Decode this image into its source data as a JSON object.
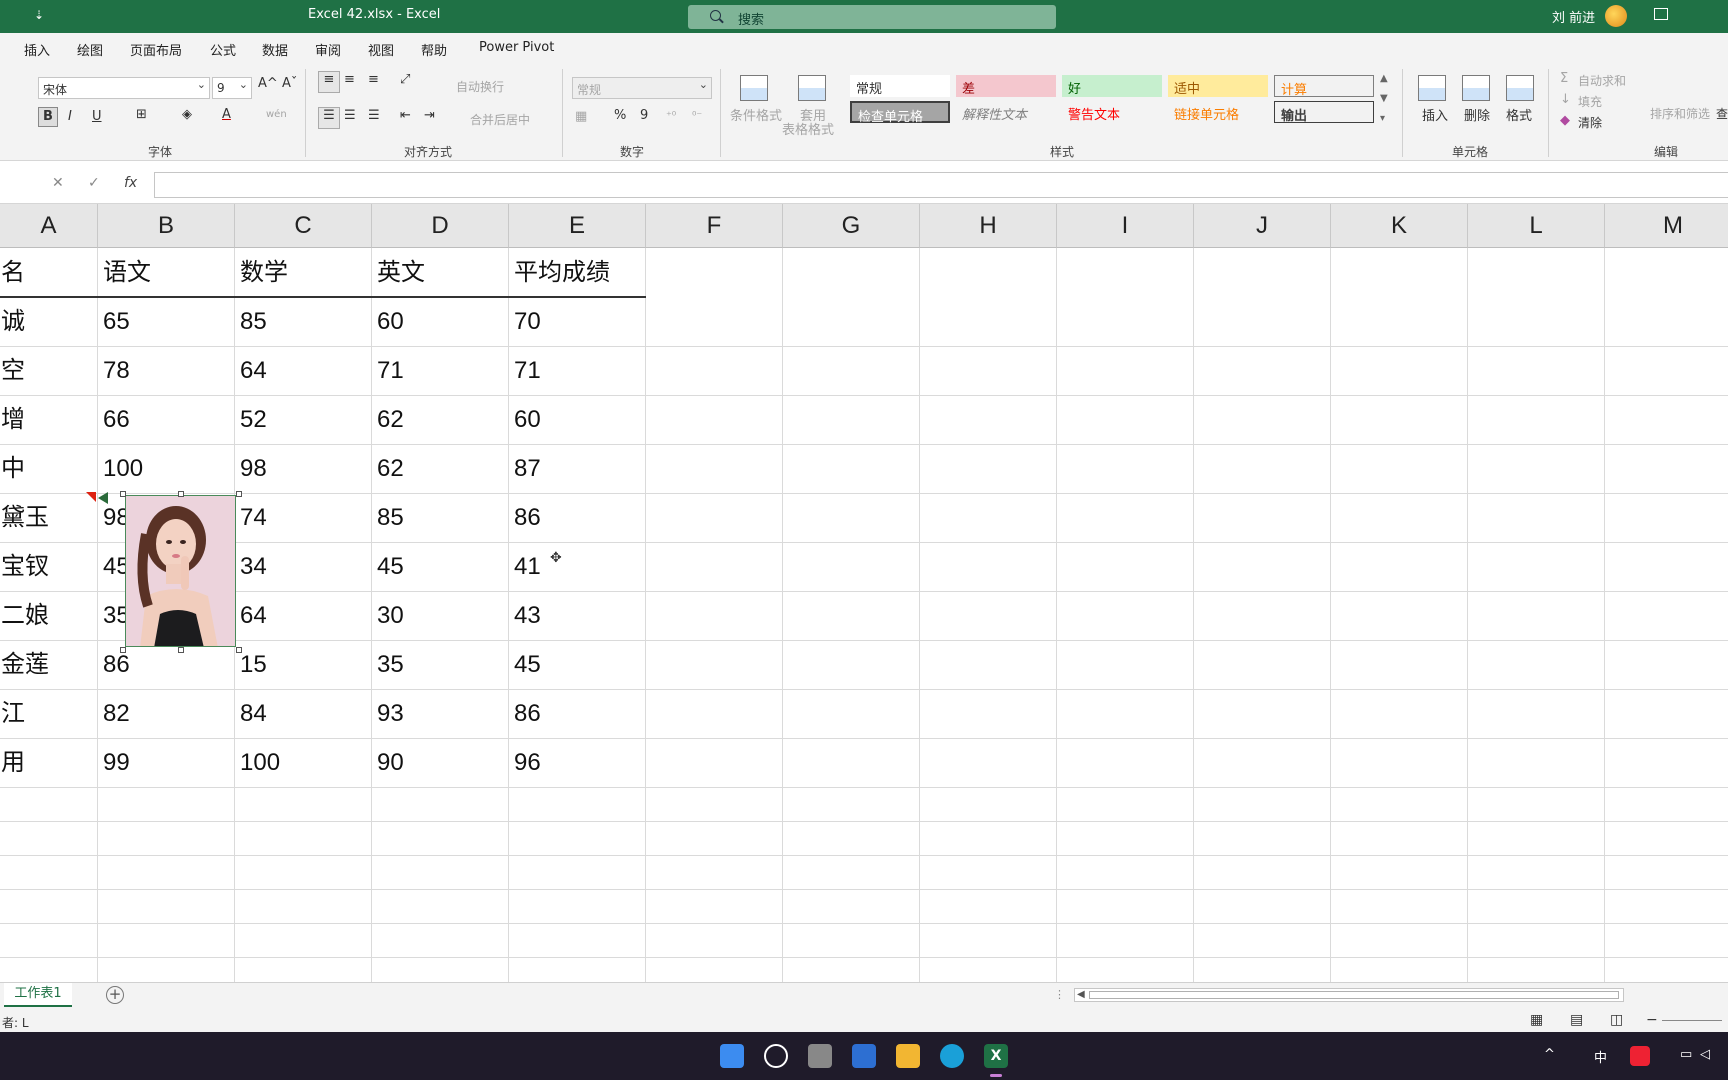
{
  "titlebar": {
    "doc_title": "Excel 42.xlsx  -  Excel",
    "search_placeholder": "搜索",
    "user_name": "刘 前进",
    "qat_glyph": "⇣"
  },
  "menu_tabs": [
    "插入",
    "绘图",
    "页面布局",
    "公式",
    "数据",
    "审阅",
    "视图",
    "帮助",
    "Power Pivot"
  ],
  "ribbon": {
    "font": {
      "name": "宋体",
      "size": "9",
      "group_label": "字体",
      "bold": "B",
      "italic": "I",
      "underline": "U",
      "grow": "A^",
      "shrink": "Aˇ",
      "wen": "wén"
    },
    "alignment": {
      "group_label": "对齐方式",
      "wrap_text": "自动换行",
      "merge_center": "合并后居中"
    },
    "number": {
      "group_label": "数字",
      "format": "常规",
      "percent": "%",
      "comma": "9"
    },
    "styles": {
      "group_label": "样式",
      "conditional_format": "条件格式",
      "format_as_table_1": "套用",
      "format_as_table_2": "表格格式",
      "cells": [
        {
          "label": "常规"
        },
        {
          "label": "差"
        },
        {
          "label": "好"
        },
        {
          "label": "适中"
        },
        {
          "label": "计算"
        },
        {
          "label": "检查单元格"
        },
        {
          "label": "解释性文本"
        },
        {
          "label": "警告文本"
        },
        {
          "label": "链接单元格"
        },
        {
          "label": "输出"
        }
      ]
    },
    "cells_group": {
      "group_label": "单元格",
      "insert": "插入",
      "delete": "删除",
      "format": "格式"
    },
    "editing": {
      "group_label": "编辑",
      "autosum": "自动求和",
      "fill": "填充",
      "clear": "清除",
      "sort_filter": "排序和筛选",
      "find": "查"
    }
  },
  "formula_bar": {
    "cancel": "✕",
    "enter": "✓",
    "fx": "fx",
    "value": ""
  },
  "columns": [
    "A",
    "B",
    "C",
    "D",
    "E",
    "F",
    "G",
    "H",
    "I",
    "J",
    "K",
    "L",
    "M"
  ],
  "table": {
    "headers": [
      "名",
      "语文",
      "数学",
      "英文",
      "平均成绩"
    ],
    "rows": [
      [
        "诚",
        "65",
        "85",
        "60",
        "70"
      ],
      [
        "空",
        "78",
        "64",
        "71",
        "71"
      ],
      [
        "增",
        "66",
        "52",
        "62",
        "60"
      ],
      [
        "中",
        "100",
        "98",
        "62",
        "87"
      ],
      [
        "黛玉",
        "98",
        "74",
        "85",
        "86"
      ],
      [
        "宝钗",
        "45",
        "34",
        "45",
        "41"
      ],
      [
        "二娘",
        "35",
        "64",
        "30",
        "43"
      ],
      [
        "金莲",
        "86",
        "15",
        "35",
        "45"
      ],
      [
        "江",
        "82",
        "84",
        "93",
        "86"
      ],
      [
        "用",
        "99",
        "100",
        "90",
        "96"
      ]
    ]
  },
  "sheets": [
    "工作表1"
  ],
  "status": {
    "left_text": "者: L"
  },
  "taskbar": {
    "tray_lang": "中"
  }
}
